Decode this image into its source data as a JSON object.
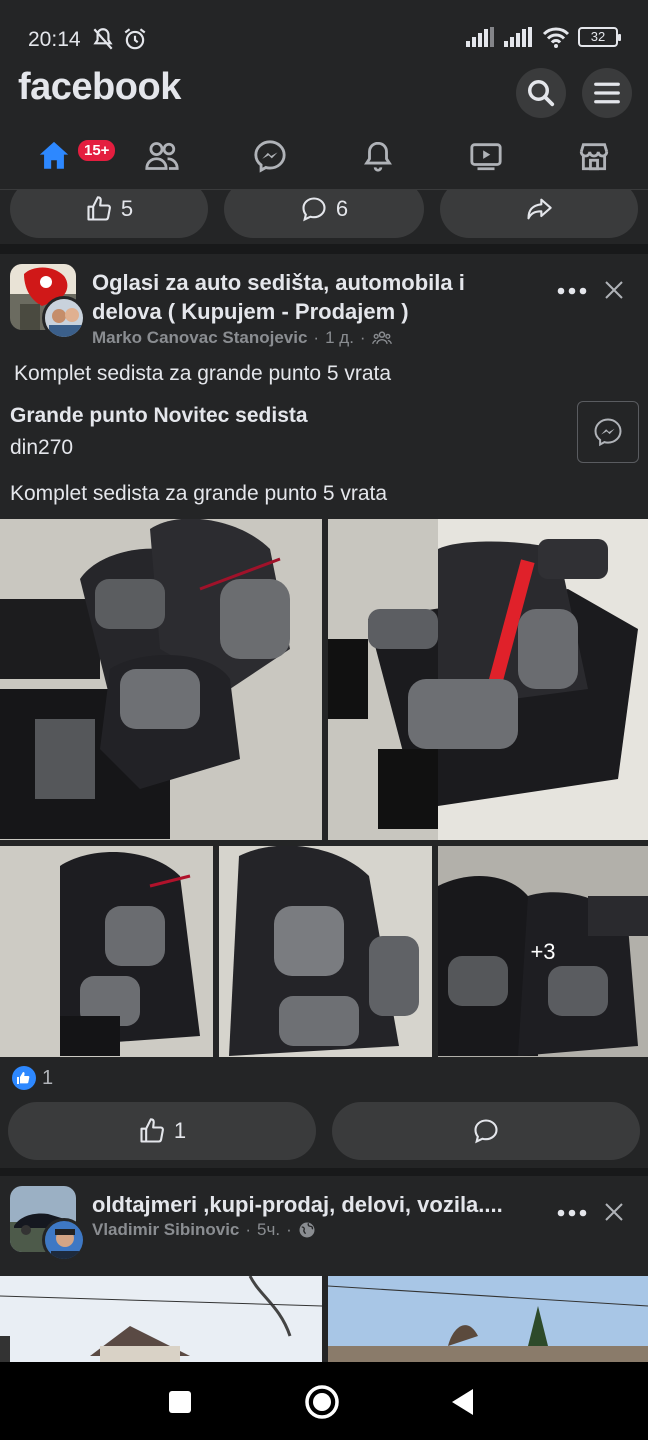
{
  "status_bar": {
    "time": "20:14",
    "battery": "32"
  },
  "header": {
    "logo": "facebook"
  },
  "tabs": {
    "home_badge": "15+"
  },
  "prev_post": {
    "like_count": "5",
    "comment_count": "6"
  },
  "post1": {
    "group_name": "Oglasi za auto sedišta, automobila i delova ( Kupujem - Prodajem )",
    "author": "Marko Canovac Stanojevic",
    "time": "1 д.",
    "text_top": "Komplet sedista za grande punto 5 vrata",
    "listing_title": "Grande punto Novitec sedista",
    "price": "din270",
    "text_bottom": "Komplet sedista za grande punto 5 vrata",
    "more_photos": "+3",
    "reaction_count": "1",
    "like_count": "1"
  },
  "post2": {
    "group_name": "oldtajmeri ,kupi-prodaj, delovi, vozila....",
    "author": "Vladimir Sibinovic",
    "time": "5ч."
  },
  "icons": {
    "home": "home-icon",
    "friends": "friends-icon",
    "messenger": "messenger-icon",
    "notifications": "bell-icon",
    "video": "video-icon",
    "marketplace": "marketplace-icon",
    "search": "search-icon",
    "menu": "menu-icon",
    "like": "thumbs-up-icon",
    "comment": "comment-icon",
    "share": "share-icon",
    "more": "more-icon",
    "close": "close-icon"
  },
  "colors": {
    "accent": "#2d88ff",
    "background": "#18191a",
    "surface": "#242526",
    "badge": "#e41e3f"
  }
}
